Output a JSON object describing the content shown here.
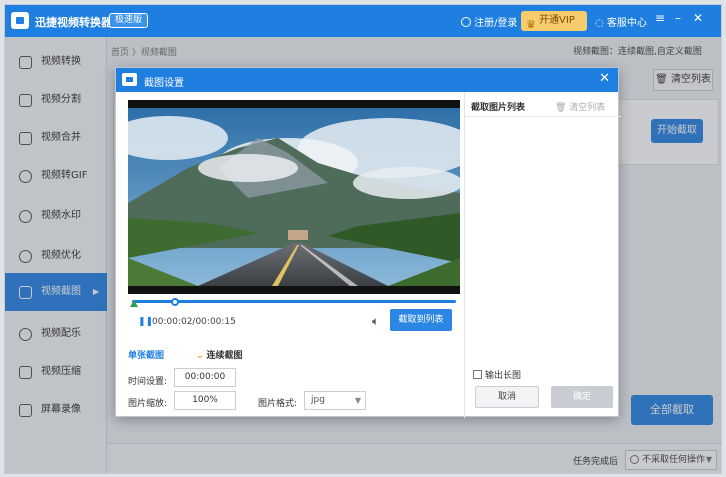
{
  "app": {
    "title": "迅捷视频转换器",
    "edition": "极速版",
    "login": "注册/登录",
    "vip": "开通VIP",
    "service": "客服中心"
  },
  "sidebar": {
    "items": [
      {
        "label": "视频转换",
        "icon": "video-convert-icon"
      },
      {
        "label": "视频分割",
        "icon": "video-split-icon"
      },
      {
        "label": "视频合并",
        "icon": "video-merge-icon"
      },
      {
        "label": "视频转GIF",
        "icon": "gif-icon"
      },
      {
        "label": "视频水印",
        "icon": "watermark-icon"
      },
      {
        "label": "视频优化",
        "icon": "optimize-icon"
      },
      {
        "label": "视频截图",
        "icon": "screenshot-icon",
        "active": true
      },
      {
        "label": "视频配乐",
        "icon": "music-icon"
      },
      {
        "label": "视频压缩",
        "icon": "compress-icon"
      },
      {
        "label": "屏幕录像",
        "icon": "screen-record-icon"
      }
    ]
  },
  "main": {
    "breadcrumb": "首页 〉视频截图",
    "right_hint": "视频截图：连续截图,自定义截图",
    "clear_list": "清空列表",
    "panel_edge": "t",
    "start_capture": "开始截取",
    "capture_all": "全部截取",
    "footer_label": "任务完成后",
    "footer_option": "不采取任何操作"
  },
  "dialog": {
    "title": "截图设置",
    "time_display": "00:00:02/00:00:15",
    "capture_to_list": "截取到列表",
    "tab_single": "单张截图",
    "tab_continuous": "连续截图",
    "time_label": "时间设置:",
    "time_value": "00:00:00",
    "scale_label": "图片缩放:",
    "scale_value": "100%",
    "format_label": "图片格式:",
    "format_value": "jpg",
    "list_title": "截取图片列表",
    "list_clear": "清空列表",
    "long_image": "输出长图",
    "cancel": "取消",
    "ok": "确定"
  },
  "player": {
    "position_seconds": 2,
    "duration_seconds": 15
  },
  "colors": {
    "brand_blue": "#1f7fe0",
    "vip_gold": "#f7cc6d"
  }
}
